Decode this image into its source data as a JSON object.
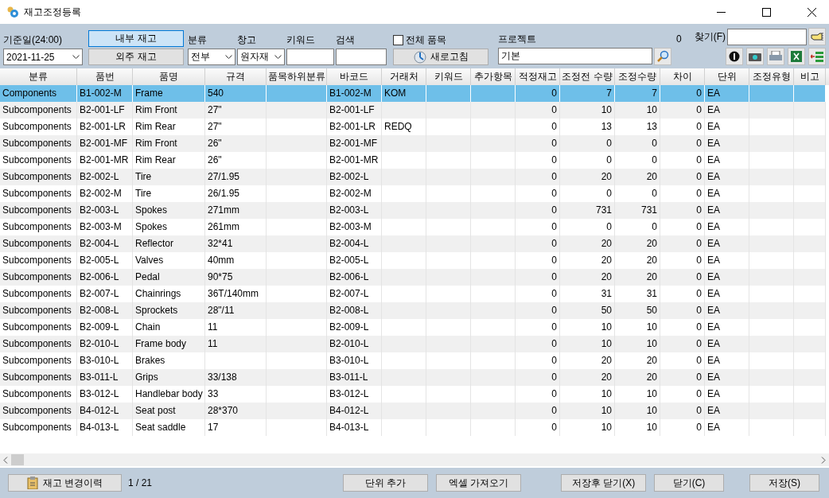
{
  "window": {
    "title": "재고조정등록"
  },
  "toolbar": {
    "date_label": "기준일(24:00)",
    "date_value": "2021-11-25",
    "stock_tabs": [
      {
        "label": "내부 재고",
        "selected": true
      },
      {
        "label": "외주 재고",
        "selected": false
      }
    ],
    "category_label": "분류",
    "category_value": "전부",
    "warehouse_label": "창고",
    "warehouse_value": "원자재",
    "keyword_label": "키워드",
    "search_label": "검색",
    "all_items": {
      "label": "전체 품목",
      "checked": false
    },
    "refresh_button": "새로고침",
    "project_label": "프로젝트",
    "project_value": "기본",
    "count": "0",
    "find_label": "찾기(F)"
  },
  "table": {
    "columns": [
      "분류",
      "품번",
      "품명",
      "규격",
      "품목하위분류",
      "바코드",
      "거래처",
      "키워드",
      "추가항목",
      "적정재고",
      "조정전 수량",
      "조정수량",
      "차이",
      "단위",
      "조정유형",
      "비고"
    ],
    "rows": [
      {
        "selected": true,
        "category": "Components",
        "part_no": "B1-002-M",
        "name": "Frame",
        "spec": "540",
        "barcode": "B1-002-M",
        "vendor": "KOM",
        "optimal": "0",
        "before": "7",
        "adjusted": "7",
        "diff": "0",
        "unit": "EA"
      },
      {
        "selected": false,
        "category": "Subcomponents",
        "part_no": "B2-001-LF",
        "name": "Rim Front",
        "spec": "27\"",
        "barcode": "B2-001-LF",
        "optimal": "0",
        "before": "10",
        "adjusted": "10",
        "diff": "0",
        "unit": "EA"
      },
      {
        "selected": false,
        "category": "Subcomponents",
        "part_no": "B2-001-LR",
        "name": "Rim Rear",
        "spec": "27\"",
        "barcode": "B2-001-LR",
        "vendor": "REDQ",
        "optimal": "0",
        "before": "13",
        "adjusted": "13",
        "diff": "0",
        "unit": "EA"
      },
      {
        "selected": false,
        "category": "Subcomponents",
        "part_no": "B2-001-MF",
        "name": "Rim Front",
        "spec": "26\"",
        "barcode": "B2-001-MF",
        "optimal": "0",
        "before": "0",
        "adjusted": "0",
        "diff": "0",
        "unit": "EA"
      },
      {
        "selected": false,
        "category": "Subcomponents",
        "part_no": "B2-001-MR",
        "name": "Rim Rear",
        "spec": "26\"",
        "barcode": "B2-001-MR",
        "optimal": "0",
        "before": "0",
        "adjusted": "0",
        "diff": "0",
        "unit": "EA"
      },
      {
        "selected": false,
        "category": "Subcomponents",
        "part_no": "B2-002-L",
        "name": "Tire",
        "spec": "27/1.95",
        "barcode": "B2-002-L",
        "optimal": "0",
        "before": "20",
        "adjusted": "20",
        "diff": "0",
        "unit": "EA"
      },
      {
        "selected": false,
        "category": "Subcomponents",
        "part_no": "B2-002-M",
        "name": "Tire",
        "spec": "26/1.95",
        "barcode": "B2-002-M",
        "optimal": "0",
        "before": "0",
        "adjusted": "0",
        "diff": "0",
        "unit": "EA"
      },
      {
        "selected": false,
        "category": "Subcomponents",
        "part_no": "B2-003-L",
        "name": "Spokes",
        "spec": "271mm",
        "barcode": "B2-003-L",
        "optimal": "0",
        "before": "731",
        "adjusted": "731",
        "diff": "0",
        "unit": "EA"
      },
      {
        "selected": false,
        "category": "Subcomponents",
        "part_no": "B2-003-M",
        "name": "Spokes",
        "spec": "261mm",
        "barcode": "B2-003-M",
        "optimal": "0",
        "before": "0",
        "adjusted": "0",
        "diff": "0",
        "unit": "EA"
      },
      {
        "selected": false,
        "category": "Subcomponents",
        "part_no": "B2-004-L",
        "name": "Reflector",
        "spec": "32*41",
        "barcode": "B2-004-L",
        "optimal": "0",
        "before": "20",
        "adjusted": "20",
        "diff": "0",
        "unit": "EA"
      },
      {
        "selected": false,
        "category": "Subcomponents",
        "part_no": "B2-005-L",
        "name": "Valves",
        "spec": "40mm",
        "barcode": "B2-005-L",
        "optimal": "0",
        "before": "20",
        "adjusted": "20",
        "diff": "0",
        "unit": "EA"
      },
      {
        "selected": false,
        "category": "Subcomponents",
        "part_no": "B2-006-L",
        "name": "Pedal",
        "spec": "90*75",
        "barcode": "B2-006-L",
        "optimal": "0",
        "before": "20",
        "adjusted": "20",
        "diff": "0",
        "unit": "EA"
      },
      {
        "selected": false,
        "category": "Subcomponents",
        "part_no": "B2-007-L",
        "name": "Chainrings",
        "spec": "36T/140mm",
        "barcode": "B2-007-L",
        "optimal": "0",
        "before": "31",
        "adjusted": "31",
        "diff": "0",
        "unit": "EA"
      },
      {
        "selected": false,
        "category": "Subcomponents",
        "part_no": "B2-008-L",
        "name": "Sprockets",
        "spec": "28\"/11",
        "barcode": "B2-008-L",
        "optimal": "0",
        "before": "50",
        "adjusted": "50",
        "diff": "0",
        "unit": "EA"
      },
      {
        "selected": false,
        "category": "Subcomponents",
        "part_no": "B2-009-L",
        "name": "Chain",
        "spec": "11",
        "barcode": "B2-009-L",
        "optimal": "0",
        "before": "10",
        "adjusted": "10",
        "diff": "0",
        "unit": "EA"
      },
      {
        "selected": false,
        "category": "Subcomponents",
        "part_no": "B2-010-L",
        "name": "Frame body",
        "spec": "11",
        "barcode": "B2-010-L",
        "optimal": "0",
        "before": "10",
        "adjusted": "10",
        "diff": "0",
        "unit": "EA"
      },
      {
        "selected": false,
        "category": "Subcomponents",
        "part_no": "B3-010-L",
        "name": "Brakes",
        "barcode": "B3-010-L",
        "optimal": "0",
        "before": "20",
        "adjusted": "20",
        "diff": "0",
        "unit": "EA"
      },
      {
        "selected": false,
        "category": "Subcomponents",
        "part_no": "B3-011-L",
        "name": "Grips",
        "spec": "33/138",
        "barcode": "B3-011-L",
        "optimal": "0",
        "before": "20",
        "adjusted": "20",
        "diff": "0",
        "unit": "EA"
      },
      {
        "selected": false,
        "category": "Subcomponents",
        "part_no": "B3-012-L",
        "name": "Handlebar body",
        "spec": "33",
        "barcode": "B3-012-L",
        "optimal": "0",
        "before": "10",
        "adjusted": "10",
        "diff": "0",
        "unit": "EA"
      },
      {
        "selected": false,
        "category": "Subcomponents",
        "part_no": "B4-012-L",
        "name": "Seat post",
        "spec": "28*370",
        "barcode": "B4-012-L",
        "optimal": "0",
        "before": "10",
        "adjusted": "10",
        "diff": "0",
        "unit": "EA"
      },
      {
        "selected": false,
        "category": "Subcomponents",
        "part_no": "B4-013-L",
        "name": "Seat saddle",
        "spec": "17",
        "barcode": "B4-013-L",
        "optimal": "0",
        "before": "10",
        "adjusted": "10",
        "diff": "0",
        "unit": "EA"
      }
    ]
  },
  "footer": {
    "history_button": "재고 변경이력",
    "record_count": "1 / 21",
    "buttons": [
      "단위 추가",
      "엑셀 가져오기",
      "저장후 닫기(X)",
      "닫기(C)",
      "저장(S)"
    ]
  }
}
